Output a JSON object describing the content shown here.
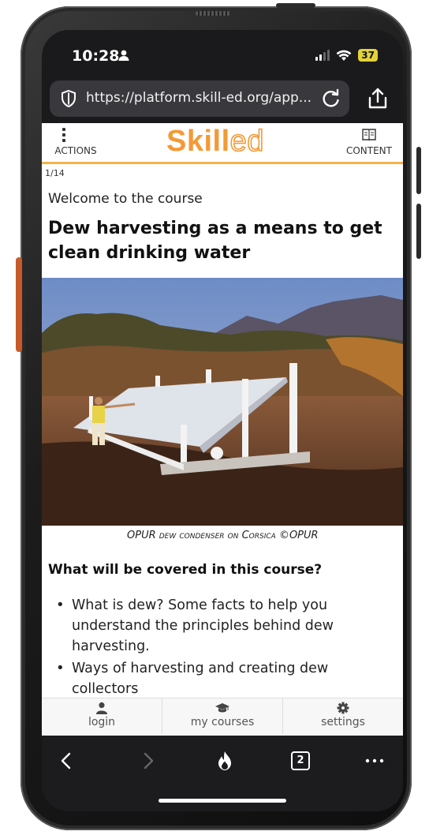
{
  "status_bar": {
    "time": "10:28",
    "battery": "37",
    "icons": [
      "person-icon",
      "signal-icon",
      "wifi-icon",
      "battery-icon"
    ]
  },
  "browser": {
    "url": "https://platform.skill-ed.org/app...",
    "tab_count": "2",
    "icons": [
      "shield-icon",
      "reload-icon",
      "share-icon",
      "back-icon",
      "forward-icon",
      "flame-icon",
      "more-icon"
    ]
  },
  "app_header": {
    "actions_label": "ACTIONS",
    "logo_skill": "Skill",
    "logo_ed": "ed",
    "content_label": "CONTENT",
    "accent_color": "#f39a36"
  },
  "course": {
    "page_counter": "1/14",
    "welcome": "Welcome to the course",
    "title": "Dew harvesting as a means to get clean drinking water",
    "image_caption": "OPUR dew condenser on Corsica ©OPUR",
    "section_heading": "What will be covered in this course?",
    "bullets": [
      "What is dew? Some facts to help you understand the principles behind dew harvesting.",
      "Ways of harvesting and creating dew collectors"
    ]
  },
  "bottom_nav": {
    "items": [
      {
        "label": "login",
        "icon": "user-icon"
      },
      {
        "label": "my courses",
        "icon": "graduation-cap-icon"
      },
      {
        "label": "settings",
        "icon": "gear-icon"
      }
    ]
  }
}
